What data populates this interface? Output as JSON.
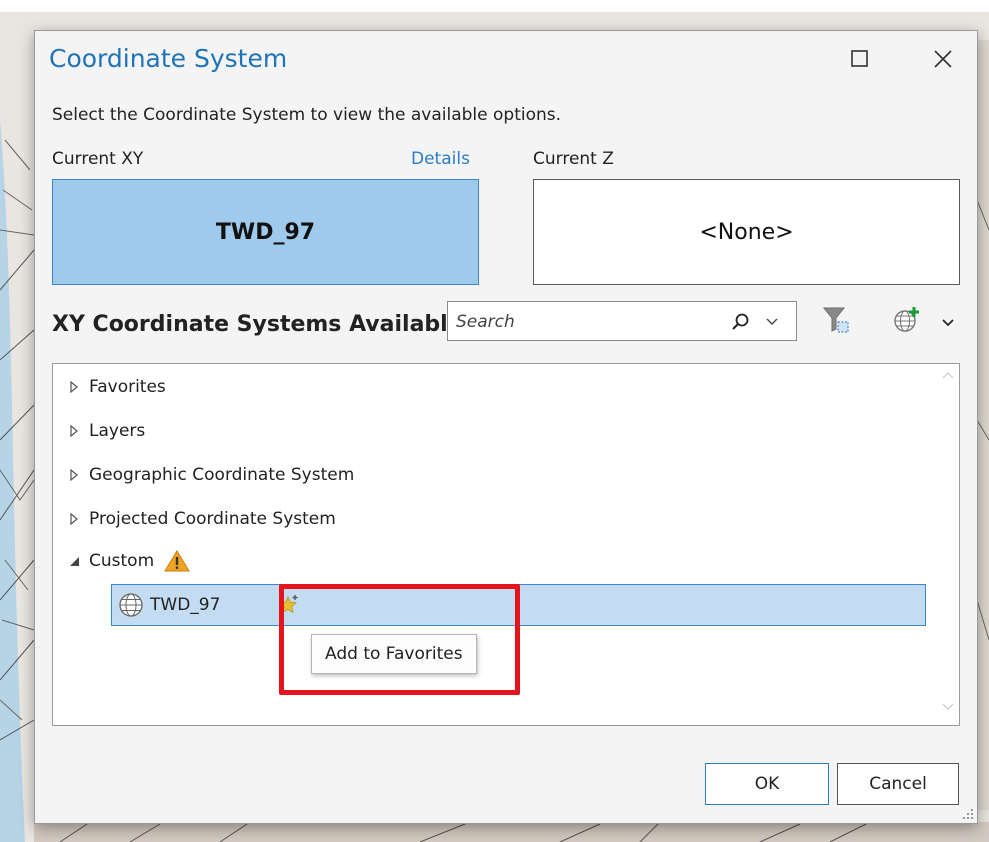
{
  "dialog": {
    "title": "Coordinate System",
    "subtitle": "Select the Coordinate System to view the available options.",
    "current_xy_label": "Current XY",
    "details_link": "Details",
    "current_z_label": "Current Z",
    "current_xy_value": "TWD_97",
    "current_z_value": "<None>",
    "section_title": "XY Coordinate Systems Available",
    "search_placeholder": "Search",
    "tree": [
      {
        "label": "Favorites",
        "expanded": false
      },
      {
        "label": "Layers",
        "expanded": false
      },
      {
        "label": "Geographic Coordinate System",
        "expanded": false
      },
      {
        "label": "Projected Coordinate System",
        "expanded": false
      },
      {
        "label": "Custom",
        "expanded": true,
        "has_warning": true
      }
    ],
    "custom_child": {
      "label": "TWD_97",
      "icon": "globe-icon",
      "action_icon": "add-favorite-star-icon"
    },
    "tooltip": "Add to Favorites",
    "ok_label": "OK",
    "cancel_label": "Cancel"
  },
  "icons": {
    "maximize": "maximize-icon",
    "close": "close-icon",
    "search": "search-icon",
    "filter": "filter-icon",
    "add_coordinate_system": "globe-add-icon",
    "warning": "warning-icon"
  },
  "colors": {
    "title": "#1f73b8",
    "link": "#2b7cc2",
    "xy_box_fill": "#9fcaeb",
    "selected_row_fill": "#c4dcf1",
    "highlight_border": "#e4141f",
    "warning": "#f0a31e"
  }
}
